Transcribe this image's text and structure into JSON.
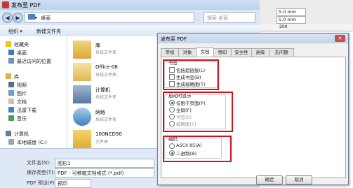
{
  "save_dialog": {
    "title": "发布至 PDF",
    "address": "桌面",
    "address_arrow": "▸",
    "search_placeholder": "搜索 桌面",
    "toolbar": {
      "organize": "组织 ▾",
      "new_folder": "新建文件夹"
    },
    "nav": {
      "favorites": "收藏夹",
      "desktop": "桌面",
      "recent": "最近访问的位置",
      "libraries": "库",
      "videos": "视频",
      "pictures": "图片",
      "documents": "文档",
      "downloads": "迅雷下载",
      "music": "音乐",
      "computer": "计算机",
      "local_disk": "本地磁盘 (C:)"
    },
    "files": [
      {
        "name": "库",
        "type": "系统文件夹"
      },
      {
        "name": "Office-08",
        "type": "系统文件夹"
      },
      {
        "name": "计算机",
        "type": "系统文件夹"
      },
      {
        "name": "网络",
        "type": "系统文件夹"
      },
      {
        "name": "100NCD90",
        "type": "文件夹"
      }
    ],
    "filename_label": "文件名(N):",
    "filename_value": "图形1",
    "savetype_label": "保存类型(T):",
    "savetype_value": "PDF - 可移植文档格式 (*.pdf)",
    "preset_label": "PDF 预设(P):",
    "preset_value": "预印"
  },
  "top_right": {
    "field1": "5.0 mm",
    "field2": "5.0 mm",
    "ruler_mark": "200"
  },
  "pdf_dialog": {
    "title": "发布至 PDF",
    "close": "✕",
    "tabs": [
      "常规",
      "对象",
      "文档",
      "预印",
      "安全性",
      "高级",
      "无问题"
    ],
    "active_tab": 2,
    "bookmarks": {
      "title": "书签",
      "options": [
        {
          "label": "包括超链接(L)",
          "checked": false
        },
        {
          "label": "生成书签(B)",
          "checked": false
        },
        {
          "label": "生成缩略图(T)",
          "checked": false
        }
      ]
    },
    "startup": {
      "title": "启动时显示",
      "options": [
        {
          "label": "仅限于页面(P)",
          "checked": true,
          "enabled": true
        },
        {
          "label": "全屏(F)",
          "checked": false,
          "enabled": true
        },
        {
          "label": "书签(S)",
          "checked": false,
          "enabled": false
        },
        {
          "label": "缩略图(T)",
          "checked": false,
          "enabled": false
        }
      ]
    },
    "encoding": {
      "title": "编码",
      "options": [
        {
          "label": "ASCII 85(A)",
          "checked": false
        },
        {
          "label": "二进制(B)",
          "checked": true
        }
      ]
    },
    "buttons": {
      "ok": "确定",
      "cancel": "取消"
    }
  }
}
